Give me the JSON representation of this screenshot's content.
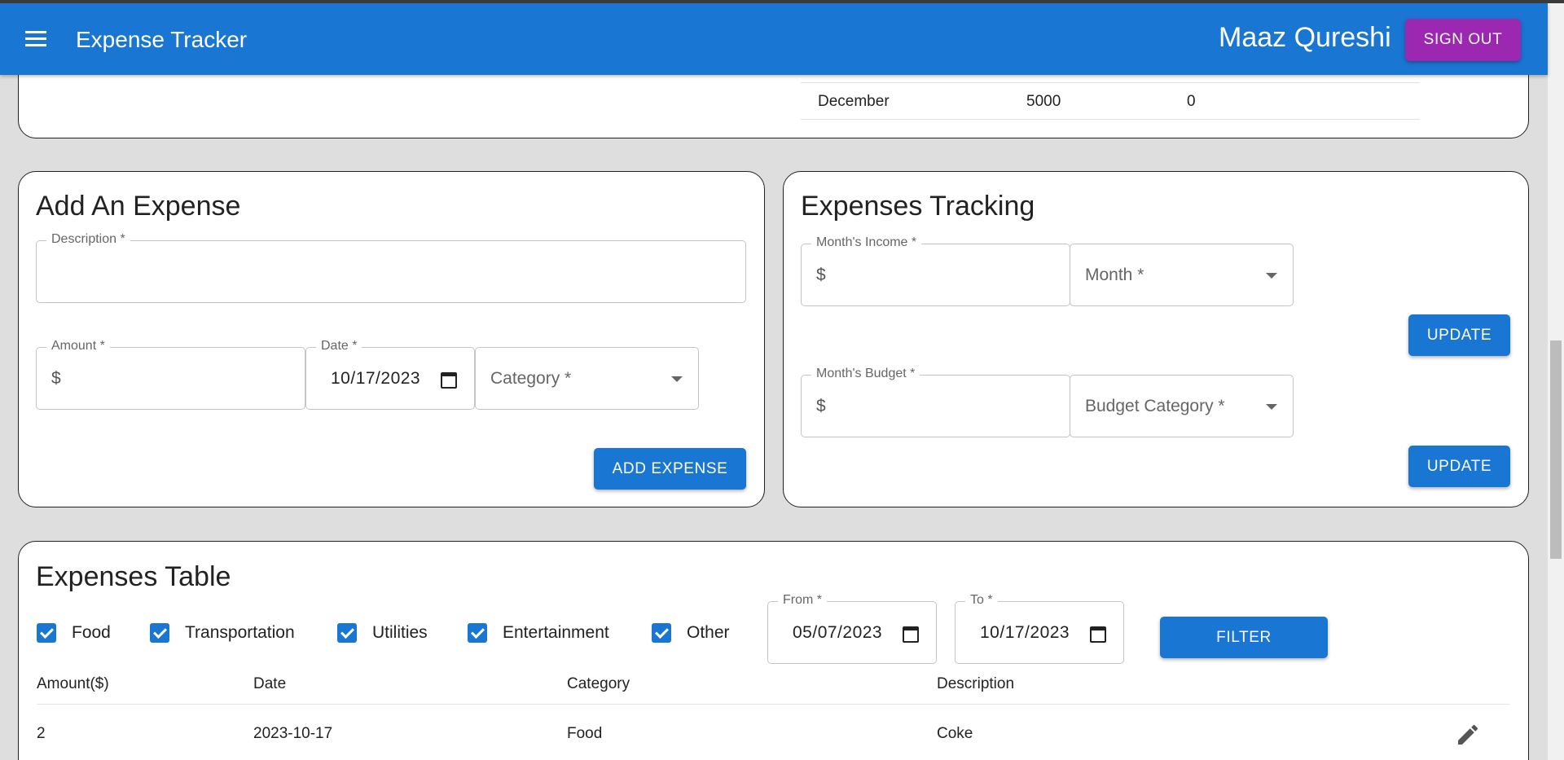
{
  "appbar": {
    "title": "Expense Tracker",
    "user_name": "Maaz Qureshi",
    "signout_label": "SIGN OUT",
    "color": "#1976d2",
    "signout_color": "#9c27b0"
  },
  "summary_row": {
    "month": "December",
    "income": "5000",
    "expense": "0"
  },
  "add_expense": {
    "title": "Add An Expense",
    "description_label": "Description *",
    "description_value": "",
    "amount_label": "Amount *",
    "amount_prefix": "$",
    "amount_value": "",
    "date_label": "Date *",
    "date_value": "10/17/2023",
    "category_placeholder": "Category *",
    "submit_label": "ADD EXPENSE"
  },
  "tracking": {
    "title": "Expenses Tracking",
    "income_label": "Month's Income *",
    "income_prefix": "$",
    "month_placeholder": "Month *",
    "update_label_1": "UPDATE",
    "budget_label": "Month's Budget *",
    "budget_prefix": "$",
    "budget_category_placeholder": "Budget Category *",
    "update_label_2": "UPDATE"
  },
  "expenses_table": {
    "title": "Expenses Table",
    "filters": [
      {
        "label": "Food",
        "checked": true
      },
      {
        "label": "Transportation",
        "checked": true
      },
      {
        "label": "Utilities",
        "checked": true
      },
      {
        "label": "Entertainment",
        "checked": true
      },
      {
        "label": "Other",
        "checked": true
      }
    ],
    "from_label": "From *",
    "from_value": "05/07/2023",
    "to_label": "To *",
    "to_value": "10/17/2023",
    "filter_label": "FILTER",
    "columns": [
      "Amount($)",
      "Date",
      "Category",
      "Description"
    ],
    "rows": [
      {
        "amount": "2",
        "date": "2023-10-17",
        "category": "Food",
        "description": "Coke"
      }
    ]
  },
  "icons": {
    "menu": "hamburger-menu-icon",
    "calendar": "calendar-icon",
    "dropdown": "arrow-drop-down-icon",
    "edit": "pencil-edit-icon",
    "checkbox": "checkbox-checked-icon"
  }
}
